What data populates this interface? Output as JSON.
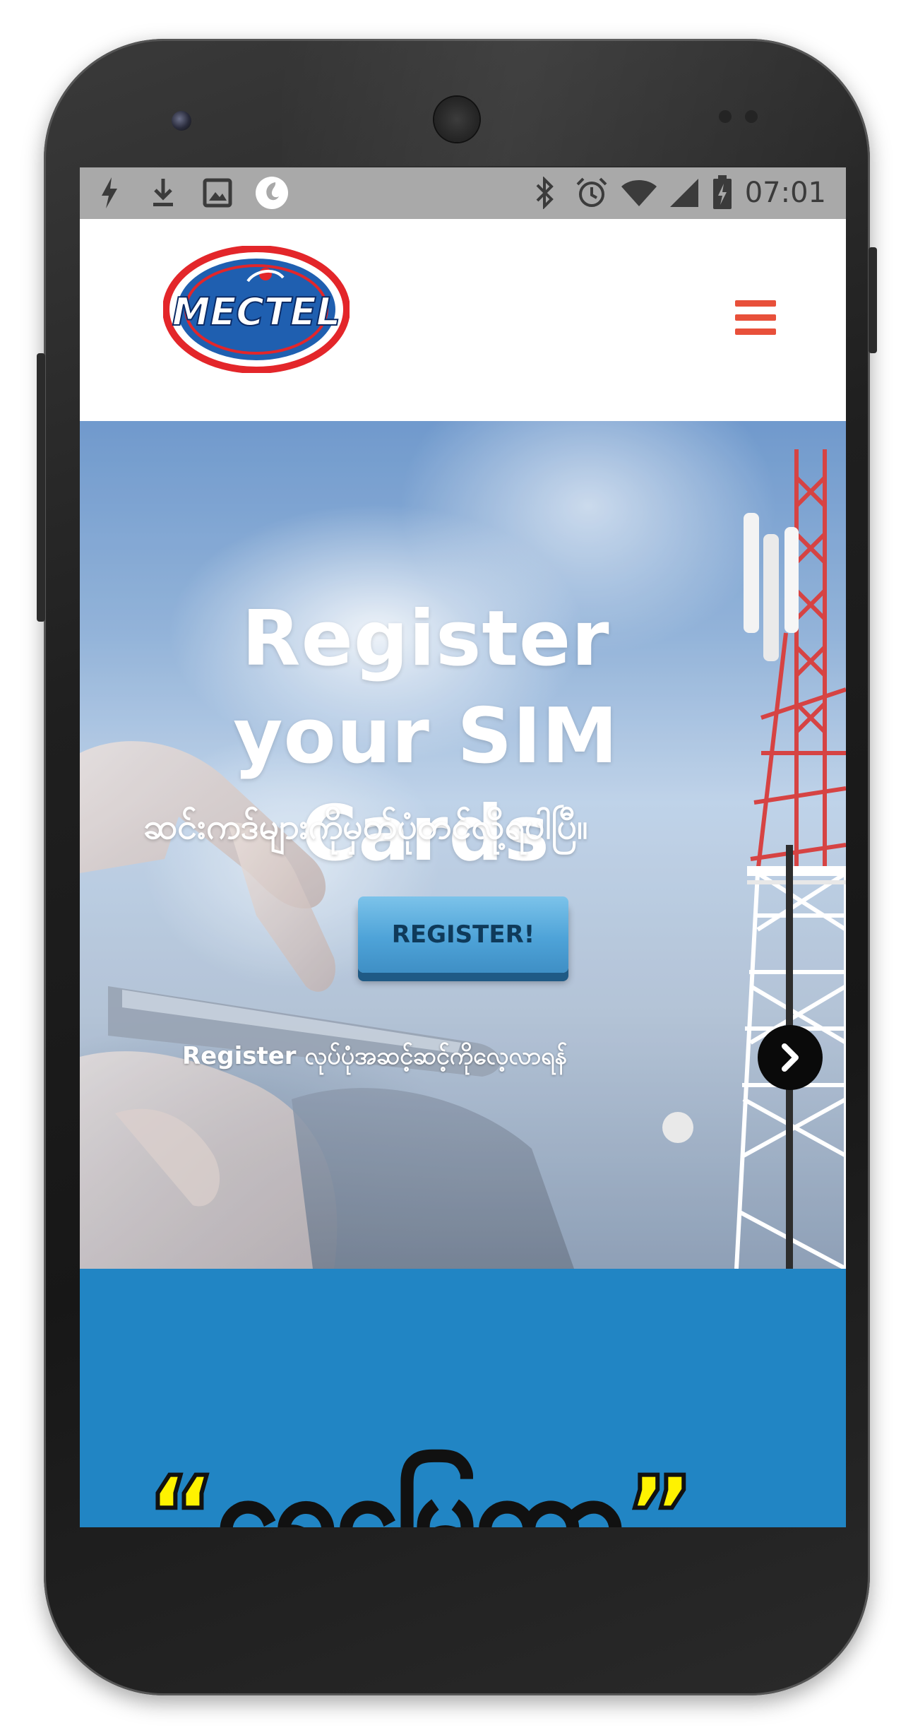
{
  "status_bar": {
    "time": "07:01",
    "left_icons": [
      "flash-icon",
      "download-icon",
      "image-icon",
      "app-icon"
    ],
    "right_icons": [
      "bluetooth-icon",
      "alarm-icon",
      "wifi-icon",
      "signal-icon",
      "battery-icon"
    ]
  },
  "header": {
    "logo_text": "MECTEL",
    "menu_icon": "hamburger-menu-icon"
  },
  "hero": {
    "title": "Register your SIM Cards",
    "subtitle": "ဆင်းကဒ်များကိုမှတ်ပုံတင်လို့ရပါပြီ။",
    "register_button": "REGISTER!",
    "howto_text": "Register လုပ်ပုံအဆင့်ဆင့်ကိုလေ့လာရန်",
    "howto_icon": "chevron-right-icon"
  },
  "promo": {
    "text": "“ရေမြေတာ”"
  },
  "colors": {
    "accent": "#e8503a",
    "promo_bg": "#2185c4",
    "button": "#4ea3d8",
    "promo_text": "#fff200"
  }
}
